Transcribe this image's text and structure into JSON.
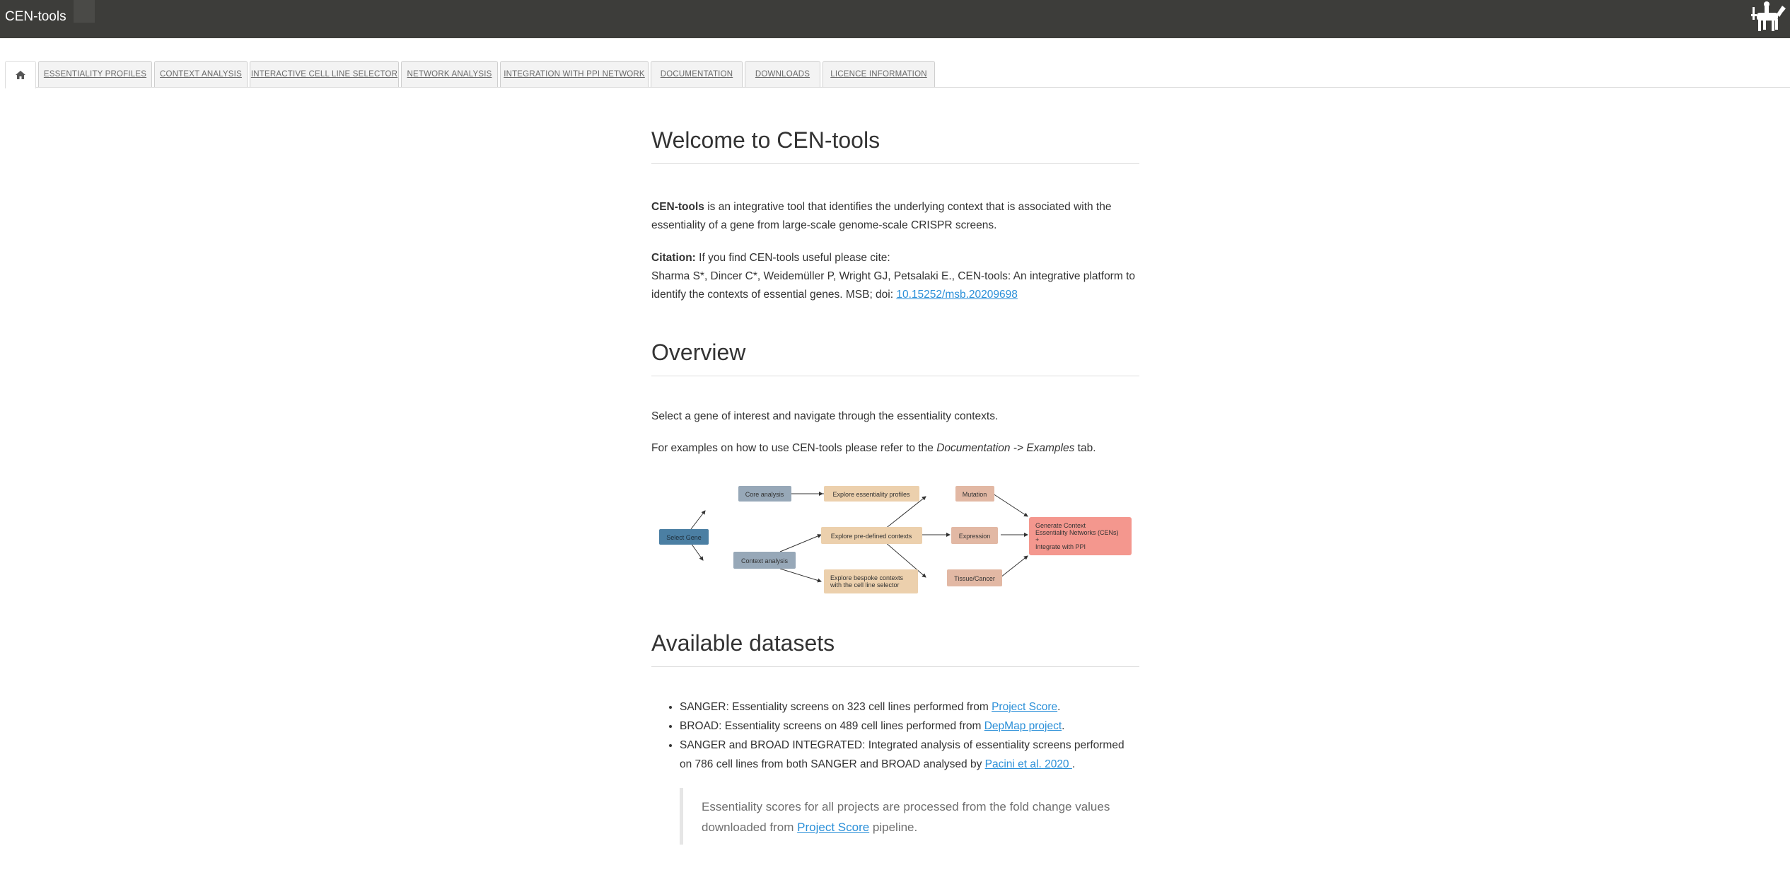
{
  "app": {
    "title": "CEN-tools"
  },
  "icons": {
    "home": "home-icon",
    "logo": "horse-rider-logo"
  },
  "tabs": [
    {
      "label": ""
    },
    {
      "label": "ESSENTIALITY PROFILES"
    },
    {
      "label": "CONTEXT ANALYSIS"
    },
    {
      "label": "INTERACTIVE CELL LINE SELECTOR"
    },
    {
      "label": "NETWORK ANALYSIS"
    },
    {
      "label": "INTEGRATION WITH PPI NETWORK"
    },
    {
      "label": "DOCUMENTATION"
    },
    {
      "label": "DOWNLOADS"
    },
    {
      "label": "LICENCE INFORMATION"
    }
  ],
  "welcome": {
    "heading": "Welcome to CEN-tools",
    "intro_bold": "CEN-tools",
    "intro_text": " is an integrative tool that identifies the underlying context that is associated with the essentiality of a gene from large-scale genome-scale CRISPR screens.",
    "citation_label": "Citation:",
    "citation_text": " If you find CEN-tools useful please cite:",
    "citation_ref": "Sharma S*, Dincer C*, Weidemüller P, Wright GJ, Petsalaki E., CEN-tools: An integrative platform to identify the contexts of essential genes. MSB; doi: ",
    "citation_doi": "10.15252/msb.20209698"
  },
  "overview": {
    "heading": "Overview",
    "line1": "Select a gene of interest and navigate through the essentiality contexts.",
    "line2_pre": "For examples on how to use CEN-tools please refer to the ",
    "line2_em": "Documentation -> Examples",
    "line2_post": " tab."
  },
  "diagram": {
    "select_gene": "Select Gene",
    "core_analysis": "Core analysis",
    "context_analysis": "Context analysis",
    "explore_profiles": "Explore essentiality profiles",
    "explore_predefined": "Explore pre-defined contexts",
    "explore_bespoke_1": "Explore bespoke contexts",
    "explore_bespoke_2": "with the cell line selector",
    "mutation": "Mutation",
    "expression": "Expression",
    "tissue_cancer": "Tissue/Cancer",
    "generate_1": "Generate Context",
    "generate_2": "Essentiality Networks (CENs)",
    "generate_3": "+",
    "generate_4": "Integrate with PPI",
    "colors": {
      "select": "#4b7fa3",
      "analysis": "#97a8b8",
      "explore": "#ecd0ad",
      "context": "#e2b8a4",
      "generate": "#f4978e"
    }
  },
  "datasets": {
    "heading": "Available datasets",
    "items": [
      {
        "pre": "SANGER: Essentiality screens on 323 cell lines performed from ",
        "link": "Project Score",
        "post": "."
      },
      {
        "pre": "BROAD: Essentiality screens on 489 cell lines performed from ",
        "link": "DepMap project",
        "post": "."
      },
      {
        "pre": "SANGER and BROAD INTEGRATED: Integrated analysis of essentiality screens performed on 786 cell lines from both SANGER and BROAD analysed by ",
        "link": "Pacini et al. 2020 ",
        "post": "."
      }
    ],
    "note_pre": "Essentiality scores for all projects are processed from the fold change values downloaded from ",
    "note_link": "Project Score",
    "note_post": " pipeline."
  }
}
